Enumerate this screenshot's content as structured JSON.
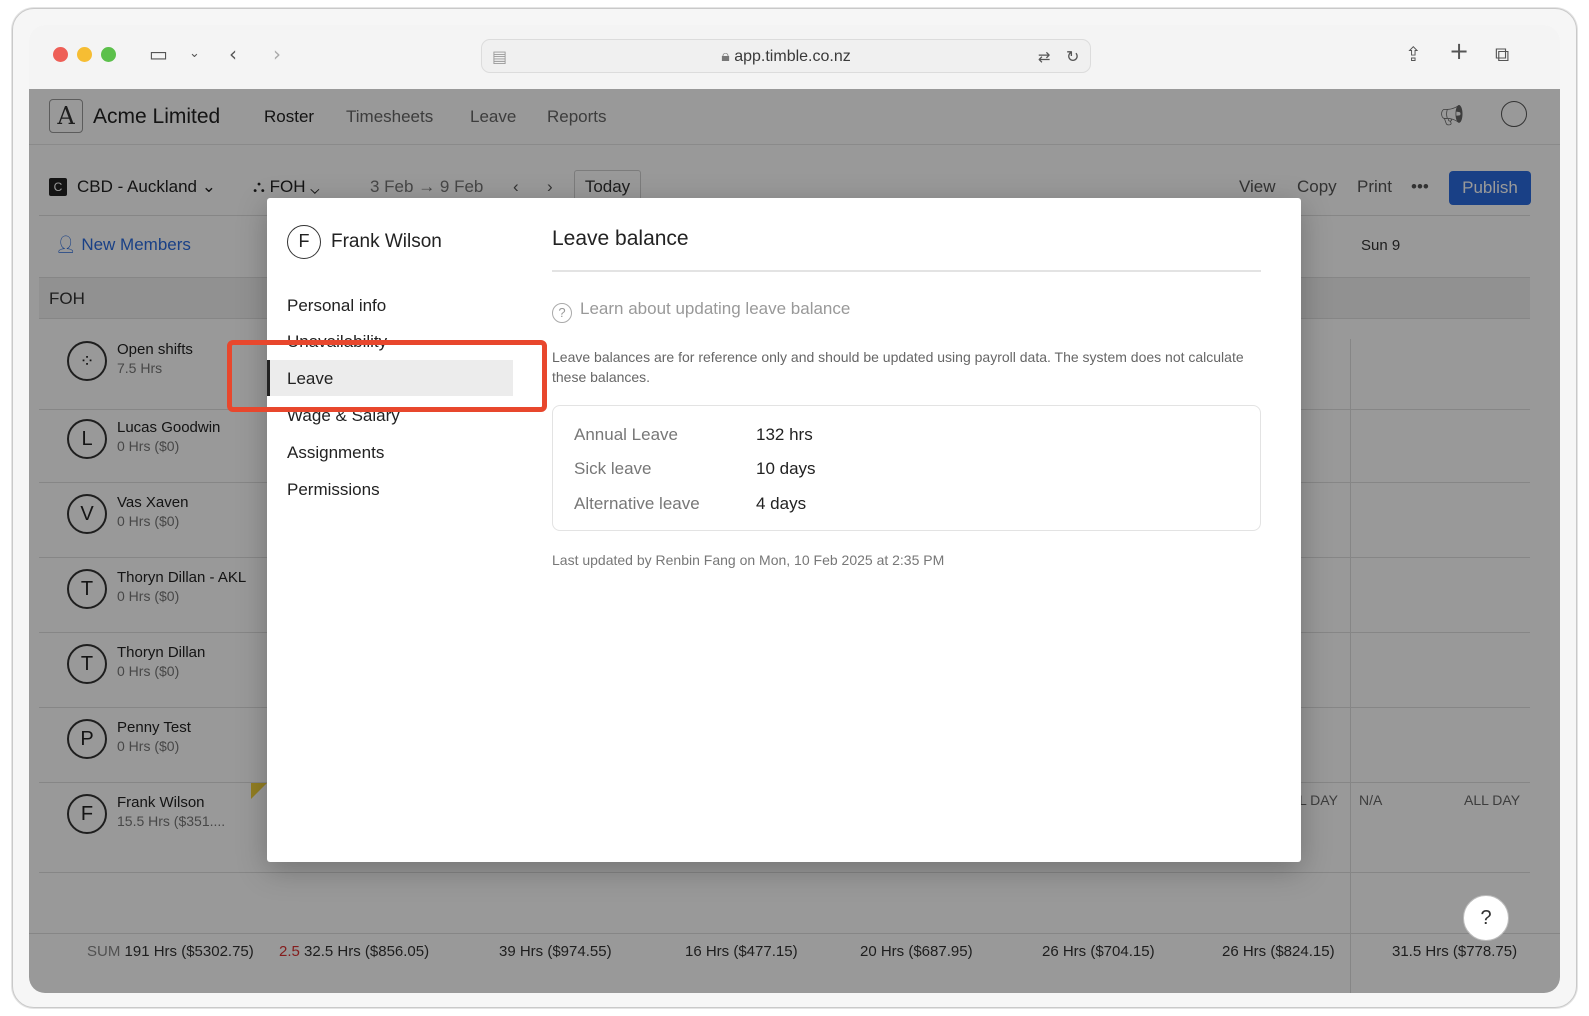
{
  "browser": {
    "url": "app.timble.co.nz"
  },
  "app": {
    "company": "Acme Limited",
    "logo_letter": "A",
    "nav": [
      "Roster",
      "Timesheets",
      "Leave",
      "Reports"
    ],
    "location": "CBD - Auckland",
    "location_badge": "C",
    "department": "FOH",
    "date_range": "3 Feb → 9 Feb",
    "today": "Today",
    "actions": [
      "View",
      "Copy",
      "Print"
    ],
    "more": "•••",
    "publish": "Publish",
    "new_members": "New Members",
    "day_header": "Sun 9",
    "group": "FOH",
    "employees": [
      {
        "initial": "⁘",
        "name": "Open shifts",
        "sub": "7.5 Hrs"
      },
      {
        "initial": "L",
        "name": "Lucas Goodwin",
        "sub": "0 Hrs ($0)"
      },
      {
        "initial": "V",
        "name": "Vas Xaven",
        "sub": "0 Hrs ($0)"
      },
      {
        "initial": "T",
        "name": "Thoryn Dillan - AKL",
        "sub": "0 Hrs ($0)"
      },
      {
        "initial": "T",
        "name": "Thoryn Dillan",
        "sub": "0 Hrs ($0)"
      },
      {
        "initial": "P",
        "name": "Penny Test",
        "sub": "0 Hrs ($0)"
      },
      {
        "initial": "F",
        "name": "Frank Wilson",
        "sub": "15.5 Hrs ($351...."
      }
    ],
    "frank_row": {
      "a": "L DAY",
      "b": "N/A",
      "c": "ALL DAY"
    },
    "footer": {
      "sum_label": "SUM",
      "sum": "191 Hrs ($5302.75)",
      "red": "2.5",
      "days": [
        "32.5 Hrs ($856.05)",
        "39 Hrs ($974.55)",
        "16 Hrs ($477.15)",
        "20 Hrs ($687.95)",
        "26 Hrs ($704.15)",
        "26 Hrs ($824.15)",
        "31.5 Hrs ($778.75)"
      ]
    },
    "help": "?"
  },
  "modal": {
    "initial": "F",
    "name": "Frank Wilson",
    "menu": [
      "Personal info",
      "Unavailability",
      "Leave",
      "Wage & Salary",
      "Assignments",
      "Permissions"
    ],
    "title": "Leave balance",
    "learn": "Learn about updating leave balance",
    "note": "Leave balances are for reference only and should be updated using payroll data. The system does not calculate these balances.",
    "balances": [
      {
        "label": "Annual Leave",
        "value": "132 hrs"
      },
      {
        "label": "Sick leave",
        "value": "10 days"
      },
      {
        "label": "Alternative leave",
        "value": "4 days"
      }
    ],
    "updated": "Last updated by Renbin Fang on Mon, 10 Feb 2025 at 2:35 PM"
  },
  "colors": {
    "publish": "#2b6cdf",
    "highlight": "#e8472d"
  }
}
